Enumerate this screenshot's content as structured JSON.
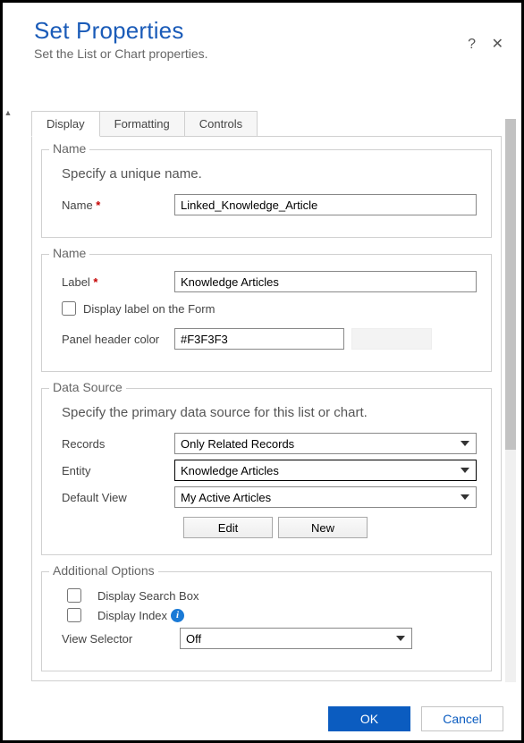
{
  "header": {
    "title": "Set Properties",
    "subtitle": "Set the List or Chart properties.",
    "help_glyph": "?",
    "close_glyph": "✕"
  },
  "tabs": [
    "Display",
    "Formatting",
    "Controls"
  ],
  "active_tab": 0,
  "section_name1": {
    "legend": "Name",
    "desc": "Specify a unique name.",
    "name_label": "Name",
    "name_value": "Linked_Knowledge_Article"
  },
  "section_name2": {
    "legend": "Name",
    "label_label": "Label",
    "label_value": "Knowledge Articles",
    "display_label_checkbox": "Display label on the Form",
    "display_label_checked": false,
    "panel_color_label": "Panel header color",
    "panel_color_value": "#F3F3F3"
  },
  "data_source": {
    "legend": "Data Source",
    "desc": "Specify the primary data source for this list or chart.",
    "records_label": "Records",
    "records_value": "Only Related Records",
    "entity_label": "Entity",
    "entity_value": "Knowledge Articles",
    "default_view_label": "Default View",
    "default_view_value": "My Active Articles",
    "edit_btn": "Edit",
    "new_btn": "New"
  },
  "additional": {
    "legend": "Additional Options",
    "search_box_label": "Display Search Box",
    "search_box_checked": false,
    "display_index_label": "Display Index",
    "display_index_checked": false,
    "view_selector_label": "View Selector",
    "view_selector_value": "Off"
  },
  "footer": {
    "ok": "OK",
    "cancel": "Cancel"
  },
  "info_glyph": "i"
}
